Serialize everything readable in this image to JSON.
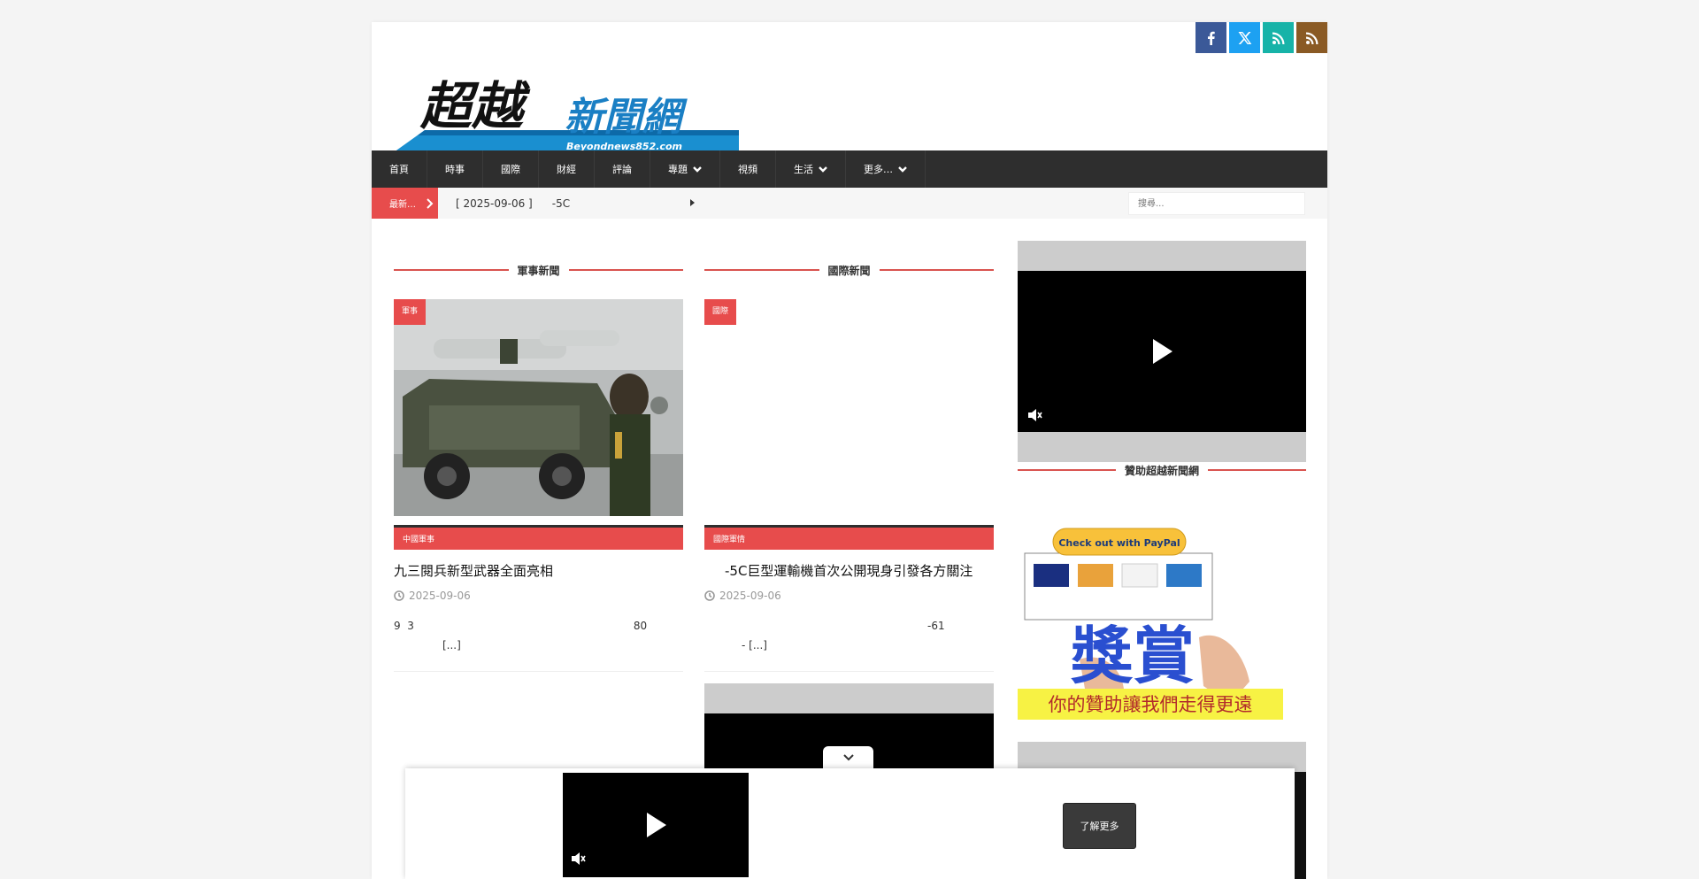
{
  "social": [
    {
      "name": "facebook",
      "color": "#3b5998"
    },
    {
      "name": "x",
      "color": "#1da1f2"
    },
    {
      "name": "rss",
      "color": "#17b3a8"
    },
    {
      "name": "rss",
      "color": "#8a5a24"
    }
  ],
  "logo": {
    "main": "超越",
    "sub": "新聞網",
    "url_text": "Beyondnews852.com"
  },
  "nav": {
    "items": [
      {
        "label": "首頁",
        "dropdown": false
      },
      {
        "label": "時事",
        "dropdown": false
      },
      {
        "label": "國際",
        "dropdown": false
      },
      {
        "label": "財經",
        "dropdown": false
      },
      {
        "label": "評論",
        "dropdown": false
      },
      {
        "label": "專題",
        "dropdown": true
      },
      {
        "label": "視頻",
        "dropdown": false
      },
      {
        "label": "生活",
        "dropdown": true
      },
      {
        "label": "更多…",
        "dropdown": true
      }
    ]
  },
  "breaking": {
    "tag": "最新…",
    "date": "[ 2025-09-06 ]",
    "title": "-5C",
    "search_placeholder": "搜尋..."
  },
  "sections": [
    {
      "header": "軍事新聞",
      "badge": "軍事",
      "category": "中國軍事",
      "title": "九三閱兵新型武器全面亮相",
      "date": "2025-09-06",
      "excerpt_line1": "9  3                                                                 80",
      "excerpt_line2": "[...]"
    },
    {
      "header": "國際新聞",
      "badge": "國際",
      "category": "國際軍情",
      "title": "-5C巨型運輸機首次公開現身引發各方關注",
      "date": "2025-09-06",
      "excerpt_line1": "-61",
      "excerpt_line2": "- [...]"
    }
  ],
  "sidebar": {
    "sponsor_header": "贊助超越新聞網",
    "promo_paypal": "Check out with PayPal",
    "promo_big": "獎賞",
    "promo_caption": "你的贊助讓我們走得更遠"
  },
  "sticky": {
    "button_label": "了解更多"
  }
}
